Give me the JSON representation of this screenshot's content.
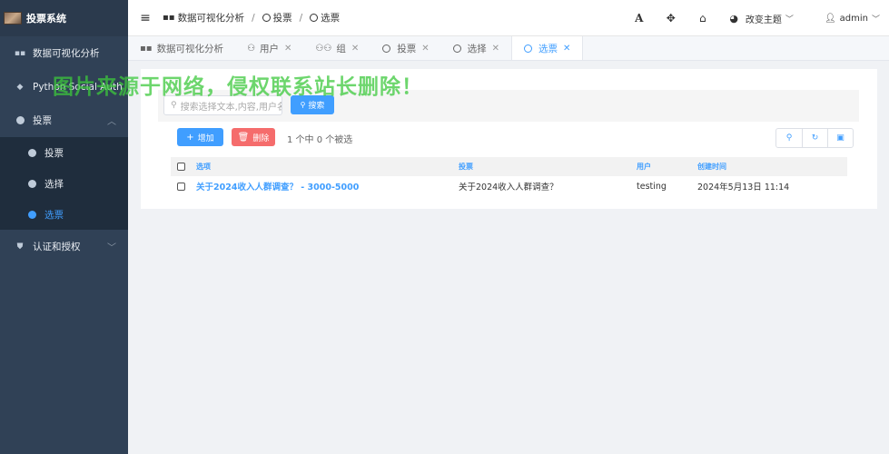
{
  "app": {
    "title": "投票系统"
  },
  "sidebar": {
    "items": [
      {
        "label": "数据可视化分析",
        "icon": "grid-icon"
      },
      {
        "label": "Python Social Auth",
        "icon": "diamond-icon"
      },
      {
        "label": "投票",
        "icon": "circle-icon",
        "expanded": true,
        "children": [
          {
            "label": "投票",
            "active": false
          },
          {
            "label": "选择",
            "active": false
          },
          {
            "label": "选票",
            "active": true
          }
        ]
      },
      {
        "label": "认证和授权",
        "icon": "shield-icon"
      }
    ]
  },
  "header": {
    "breadcrumb": [
      "数据可视化分析",
      "投票",
      "选票"
    ],
    "theme_label": "改变主题",
    "user_label": "admin"
  },
  "tabs": [
    {
      "label": "数据可视化分析",
      "icon": "grid-icon",
      "closable": false,
      "active": false
    },
    {
      "label": "用户",
      "icon": "user-icon",
      "closable": true,
      "active": false
    },
    {
      "label": "组",
      "icon": "users-icon",
      "closable": true,
      "active": false
    },
    {
      "label": "投票",
      "icon": "circle-icon",
      "closable": true,
      "active": false
    },
    {
      "label": "选择",
      "icon": "circle-icon",
      "closable": true,
      "active": false
    },
    {
      "label": "选票",
      "icon": "circle-icon",
      "closable": true,
      "active": true
    }
  ],
  "watermark": "图片来源于网络，侵权联系站长删除！",
  "search": {
    "placeholder": "搜索选择文本,内容,用户名",
    "button_label": "搜索"
  },
  "actions": {
    "add_label": "增加",
    "delete_label": "删除",
    "selection_text": "1 个中 0 个被选"
  },
  "table": {
    "columns": [
      "选项",
      "投票",
      "用户",
      "创建时间"
    ],
    "rows": [
      {
        "option": "关于2024收入人群调查？ - 3000-5000",
        "vote": "关于2024收入人群调查？",
        "user": "testing",
        "created": "2024年5月13日 11:14"
      }
    ]
  },
  "colors": {
    "primary": "#409eff",
    "danger": "#f56c6c",
    "sidebar": "#304156"
  }
}
